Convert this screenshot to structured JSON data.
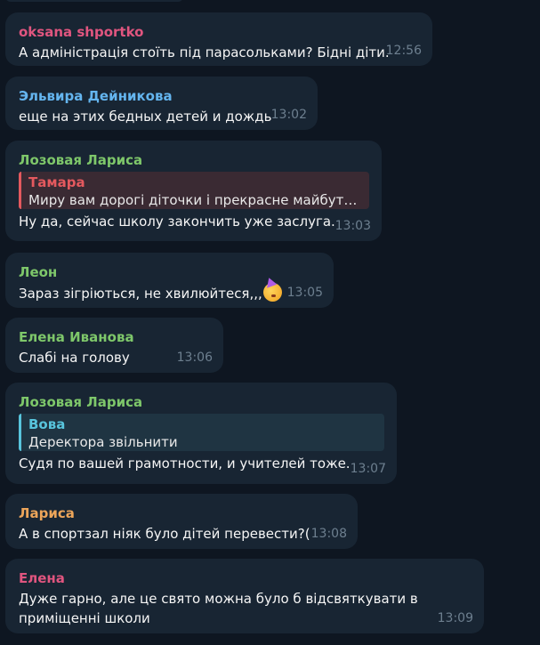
{
  "messages": [
    {
      "author": "oksana shportko",
      "author_color": "#e0557f",
      "text": "А адміністрація стоїть під парасольками? Бідні діти.",
      "time": "12:56"
    },
    {
      "author": "Эльвира Дейникова",
      "author_color": "#64b5ef",
      "text": "еще на этих бедных детей и дождь",
      "time": "13:02"
    },
    {
      "author": "Лозовая Лариса",
      "author_color": "#7ec76a",
      "reply": {
        "author": "Тамара",
        "author_color": "#e4595e",
        "text": "Миру вам дорогі діточки і прекрасне майбутн..."
      },
      "text": "Ну да, сейчас школу закончить уже заслуга.",
      "time": "13:03"
    },
    {
      "author": "Леон",
      "author_color": "#7ec76a",
      "text": "Зараз зігріються, не хвилюйтеся,,,",
      "emoji": "partying-face-emoji",
      "time": "13:05"
    },
    {
      "author": "Елена Иванова",
      "author_color": "#7ec76a",
      "text": "Слабі на голову",
      "time": "13:06"
    },
    {
      "author": "Лозовая Лариса",
      "author_color": "#7ec76a",
      "reply": {
        "author": "Вова",
        "author_color": "#58c4dc",
        "text": "Деректора звільнити"
      },
      "text": "Судя по вашей грамотности, и учителей тоже.",
      "time": "13:07"
    },
    {
      "author": "Лариса",
      "author_color": "#eca55a",
      "text": "А в спортзал ніяк було дітей перевести?(",
      "time": "13:08"
    },
    {
      "author": "Елена",
      "author_color": "#e0557f",
      "text_lines": [
        "Дуже гарно, але це свято можна було б відсвяткувати в",
        "приміщенні школи"
      ],
      "time": "13:09"
    }
  ]
}
